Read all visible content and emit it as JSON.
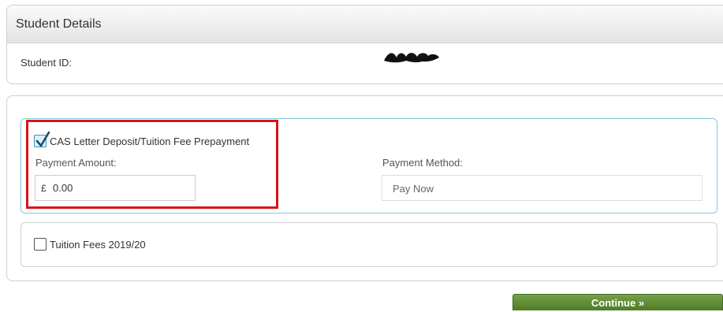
{
  "student_details": {
    "title": "Student Details",
    "student_id_label": "Student ID:"
  },
  "payment_options": {
    "cas": {
      "label": "CAS Letter Deposit/Tuition Fee Prepayment",
      "checked": true,
      "payment_amount_label": "Payment Amount:",
      "currency_symbol": "£",
      "amount_value": "0.00",
      "payment_method_label": "Payment Method:",
      "payment_method_value": "Pay Now"
    },
    "tuition": {
      "label": "Tuition Fees 2019/20",
      "checked": false
    }
  },
  "actions": {
    "continue_label": "Continue »"
  },
  "colors": {
    "highlight": "#d8141a",
    "selected_border": "#7fc8e0",
    "button_green": "#5e8a32"
  },
  "icons": {
    "check": "checkmark-icon"
  }
}
